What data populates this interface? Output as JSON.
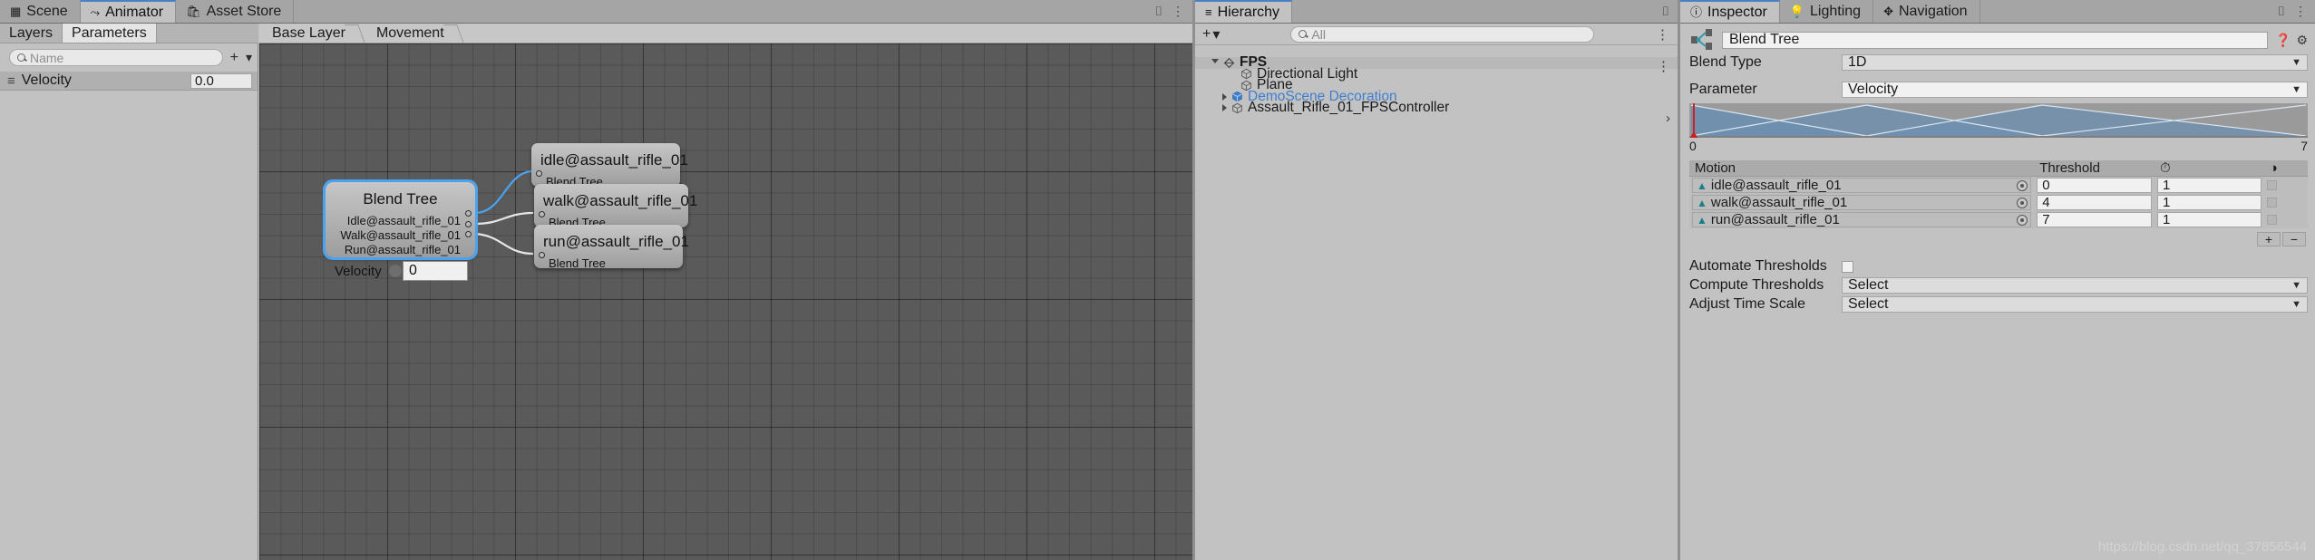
{
  "window": {
    "tabs_top_left": [
      {
        "label": "Scene",
        "icon": "grid-icon",
        "active": false
      },
      {
        "label": "Animator",
        "icon": "animator-icon",
        "active": true
      },
      {
        "label": "Asset Store",
        "icon": "store-icon",
        "active": false
      }
    ]
  },
  "animator": {
    "subtabs": [
      {
        "label": "Layers",
        "active": false
      },
      {
        "label": "Parameters",
        "active": true
      }
    ],
    "search_placeholder": "Name",
    "add_label": "+",
    "parameters": [
      {
        "name": "Velocity",
        "value": "0.0"
      }
    ],
    "breadcrumb": [
      "Base Layer",
      "Movement"
    ],
    "nodes": [
      {
        "id": "blendtree",
        "title": "Blend Tree",
        "selected": true,
        "outputs": [
          "Idle@assault_rifle_01",
          "Walk@assault_rifle_01",
          "Run@assault_rifle_01"
        ],
        "slider_label": "Velocity",
        "slider_value": "0"
      },
      {
        "id": "idle",
        "title": "idle@assault_rifle_01",
        "input": "Blend Tree"
      },
      {
        "id": "walk",
        "title": "walk@assault_rifle_01",
        "input": "Blend Tree"
      },
      {
        "id": "run",
        "title": "run@assault_rifle_01",
        "input": "Blend Tree"
      }
    ]
  },
  "hierarchy": {
    "title": "Hierarchy",
    "create_label": "+",
    "search_placeholder": "All",
    "items": [
      {
        "label": "FPS",
        "depth": 0,
        "expanded": true,
        "icon": "scene-icon",
        "selected": true,
        "prefab": false
      },
      {
        "label": "Directional Light",
        "depth": 1,
        "expanded": null,
        "icon": "gameobject-icon",
        "selected": false,
        "prefab": false
      },
      {
        "label": "Plane",
        "depth": 1,
        "expanded": null,
        "icon": "gameobject-icon",
        "selected": false,
        "prefab": false
      },
      {
        "label": "DemoScene Decoration",
        "depth": 1,
        "expanded": false,
        "icon": "prefab-icon",
        "selected": false,
        "prefab": true
      },
      {
        "label": "Assault_Rifle_01_FPSController",
        "depth": 1,
        "expanded": false,
        "icon": "gameobject-icon",
        "selected": false,
        "prefab": false
      }
    ]
  },
  "inspector": {
    "tabs": [
      {
        "label": "Inspector",
        "icon": "info-icon",
        "active": true
      },
      {
        "label": "Lighting",
        "icon": "light-icon",
        "active": false
      },
      {
        "label": "Navigation",
        "icon": "navigation-icon",
        "active": false
      }
    ],
    "asset_name": "Blend Tree",
    "blend_type_label": "Blend Type",
    "blend_type_value": "1D",
    "parameter_label": "Parameter",
    "parameter_value": "Velocity",
    "graph_min": "0",
    "graph_max": "7",
    "table_headers": {
      "motion": "Motion",
      "threshold": "Threshold",
      "speed": "speed-icon",
      "mirror": "mirror-icon"
    },
    "motions": [
      {
        "name": "idle@assault_rifle_01",
        "threshold": "0",
        "speed": "1",
        "mirror": false
      },
      {
        "name": "walk@assault_rifle_01",
        "threshold": "4",
        "speed": "1",
        "mirror": false
      },
      {
        "name": "run@assault_rifle_01",
        "threshold": "7",
        "speed": "1",
        "mirror": false
      }
    ],
    "add_button": "+",
    "remove_button": "−",
    "automate_thresholds_label": "Automate Thresholds",
    "automate_thresholds_checked": false,
    "compute_thresholds_label": "Compute Thresholds",
    "compute_thresholds_value": "Select",
    "adjust_time_scale_label": "Adjust Time Scale",
    "adjust_time_scale_value": "Select"
  },
  "watermark": "https://blog.csdn.net/qq_37856544",
  "colors": {
    "accent_blue": "#4aa3f0",
    "prefab_blue": "#3f7fd0",
    "marker_red": "#cf2020",
    "panel_bg": "#c2c2c2",
    "graph_bg": "#5a5a5a"
  }
}
